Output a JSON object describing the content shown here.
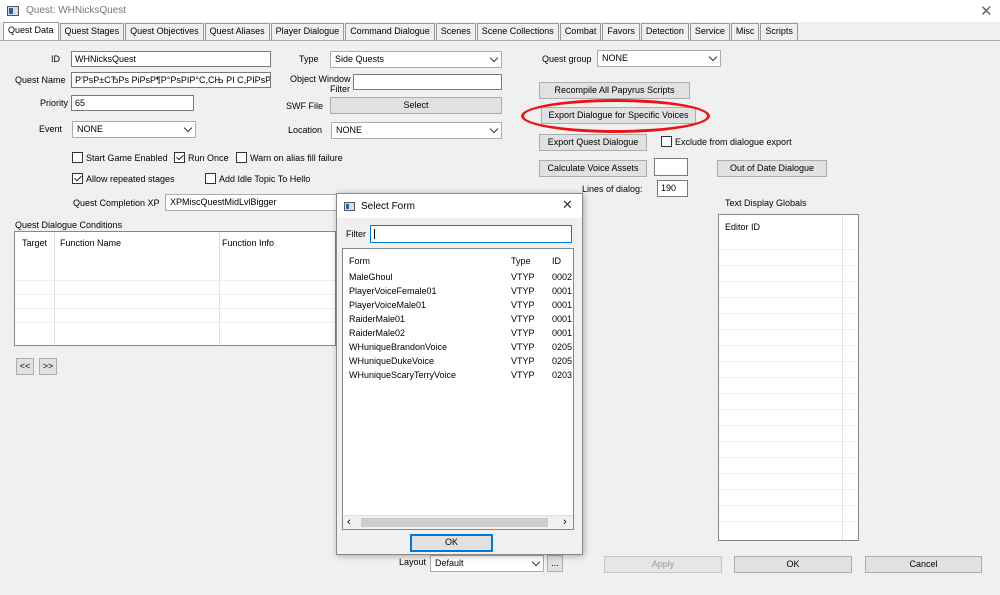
{
  "window": {
    "title": "Quest: WHNicksQuest",
    "close_glyph": "✕"
  },
  "tabs": [
    "Quest Data",
    "Quest Stages",
    "Quest Objectives",
    "Quest Aliases",
    "Player Dialogue",
    "Command Dialogue",
    "Scenes",
    "Scene Collections",
    "Combat",
    "Favors",
    "Detection",
    "Service",
    "Misc",
    "Scripts"
  ],
  "form": {
    "id_label": "ID",
    "id_value": "WHNicksQuest",
    "quest_name_label": "Quest Name",
    "quest_name_value": "Р'РsР±СЂРs РiРsР¶Р°РsРIР°С,СЊ РІ С,РIРsР",
    "priority_label": "Priority",
    "priority_value": "65",
    "event_label": "Event",
    "event_value": "NONE",
    "type_label": "Type",
    "type_value": "Side Quests",
    "object_window_filter_label_1": "Object Window",
    "object_window_filter_label_2": "Filter",
    "swf_file_label": "SWF File",
    "select_button": "Select",
    "location_label": "Location",
    "location_value": "NONE",
    "start_game_enabled": "Start Game Enabled",
    "run_once": "Run Once",
    "warn_on_alias": "Warn on alias fill failure",
    "allow_repeated": "Allow repeated stages",
    "add_idle_topic": "Add Idle Topic To Hello",
    "completion_xp_label": "Quest Completion XP",
    "completion_xp_value": "XPMiscQuestMidLvlBigger",
    "quest_group_label": "Quest group",
    "quest_group_value": "NONE",
    "recompile_button": "Recompile All Papyrus Scripts",
    "export_voices_button": "Export Dialogue for Specific Voices",
    "export_quest_button": "Export Quest Dialogue",
    "exclude_export": "Exclude from dialogue export",
    "calc_voice_button": "Calculate Voice Assets",
    "out_of_date_button": "Out of Date Dialogue",
    "lines_label": "Lines of dialog:",
    "lines_value": "190",
    "text_display_label": "Text Display Globals",
    "editor_id_header": "Editor ID",
    "conditions_label": "Quest Dialogue Conditions",
    "cond_cols": [
      "Target",
      "Function Name",
      "Function Info"
    ],
    "prev_button": "<<",
    "next_button": ">>",
    "layout_label": "Layout",
    "layout_value": "Default",
    "layout_more": "...",
    "apply_button": "Apply",
    "ok_button": "OK",
    "cancel_button": "Cancel"
  },
  "dialog": {
    "title": "Select Form",
    "close_glyph": "✕",
    "filter_label": "Filter",
    "filter_value": "",
    "columns": [
      "Form",
      "Type",
      "ID"
    ],
    "rows": [
      {
        "form": "MaleGhoul",
        "type": "VTYP",
        "id": "0002"
      },
      {
        "form": "PlayerVoiceFemale01",
        "type": "VTYP",
        "id": "0001"
      },
      {
        "form": "PlayerVoiceMale01",
        "type": "VTYP",
        "id": "0001"
      },
      {
        "form": "RaiderMale01",
        "type": "VTYP",
        "id": "0001"
      },
      {
        "form": "RaiderMale02",
        "type": "VTYP",
        "id": "0001"
      },
      {
        "form": "WHuniqueBrandonVoice",
        "type": "VTYP",
        "id": "0205"
      },
      {
        "form": "WHuniqueDukeVoice",
        "type": "VTYP",
        "id": "0205"
      },
      {
        "form": "WHuniqueScaryTerryVoice",
        "type": "VTYP",
        "id": "0203"
      }
    ],
    "ok_button": "OK",
    "scroll_left": "‹",
    "scroll_right": "›"
  }
}
